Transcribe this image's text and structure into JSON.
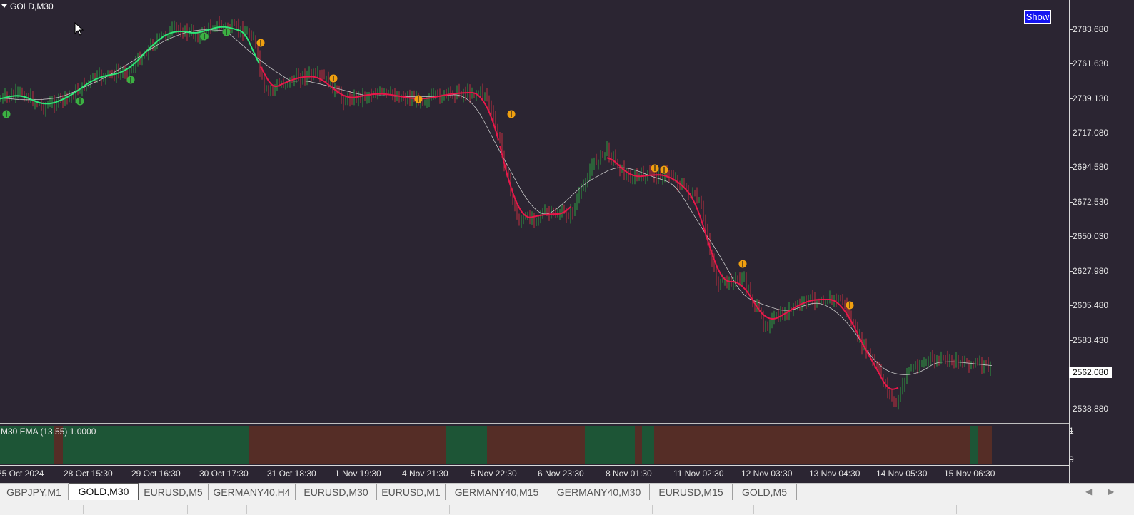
{
  "chart": {
    "symbol_title": "GOLD,M30",
    "show_button": "Show",
    "current_price": "2562.080",
    "price_labels": [
      "2783.680",
      "2761.630",
      "2739.130",
      "2717.080",
      "2694.580",
      "2672.530",
      "2650.030",
      "2627.980",
      "2605.480",
      "2583.430",
      "2538.880"
    ],
    "time_labels": [
      "25 Oct 2024",
      "28 Oct 15:30",
      "29 Oct 16:30",
      "30 Oct 17:30",
      "31 Oct 18:30",
      "1 Nov 19:30",
      "4 Nov 21:30",
      "5 Nov 22:30",
      "6 Nov 23:30",
      "8 Nov 01:30",
      "11 Nov 02:30",
      "12 Nov 03:30",
      "13 Nov 04:30",
      "14 Nov 05:30",
      "15 Nov 06:30"
    ],
    "colors": {
      "background": "#2b2532",
      "candle_up": "#2ea043",
      "candle_down": "#c03040",
      "ema_up": "#2ee878",
      "ema_down": "#e8174a",
      "ema_slow": "#c8c8c8",
      "buy_marker": "#3cb043",
      "sell_marker": "#f0a010",
      "hist_up": "#1f5a3a",
      "hist_down": "#5a3028"
    }
  },
  "indicator": {
    "label": "M30 EMA (13,55) 1.0000",
    "scale_top": "1",
    "scale_bottom": "0"
  },
  "tabs": [
    {
      "label": "GBPJPY,M1",
      "active": false
    },
    {
      "label": "GOLD,M30",
      "active": true
    },
    {
      "label": "EURUSD,M5",
      "active": false
    },
    {
      "label": "GERMANY40,H4",
      "active": false
    },
    {
      "label": "EURUSD,M30",
      "active": false
    },
    {
      "label": "EURUSD,M1",
      "active": false
    },
    {
      "label": "GERMANY40,M15",
      "active": false
    },
    {
      "label": "GERMANY40,M30",
      "active": false
    },
    {
      "label": "EURUSD,M15",
      "active": false
    },
    {
      "label": "GOLD,M5",
      "active": false
    }
  ],
  "icons": {
    "scroll_left": "scroll-left-icon",
    "scroll_right": "scroll-right-icon",
    "cursor": "mouse-cursor-icon",
    "dropdown": "dropdown-triangle-icon"
  }
}
